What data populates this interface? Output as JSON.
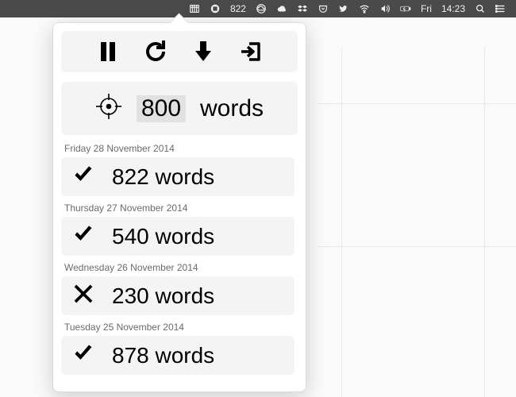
{
  "menubar": {
    "count": "822",
    "day": "Fri",
    "time": "14:23"
  },
  "target": {
    "value": "800",
    "label": "words"
  },
  "history": [
    {
      "date": "Friday 28 November 2014",
      "status": "check",
      "count": "822",
      "unit": "words"
    },
    {
      "date": "Thursday 27 November 2014",
      "status": "check",
      "count": "540",
      "unit": "words"
    },
    {
      "date": "Wednesday 26 November 2014",
      "status": "cross",
      "count": "230",
      "unit": "words"
    },
    {
      "date": "Tuesday 25 November 2014",
      "status": "check",
      "count": "878",
      "unit": "words"
    }
  ]
}
